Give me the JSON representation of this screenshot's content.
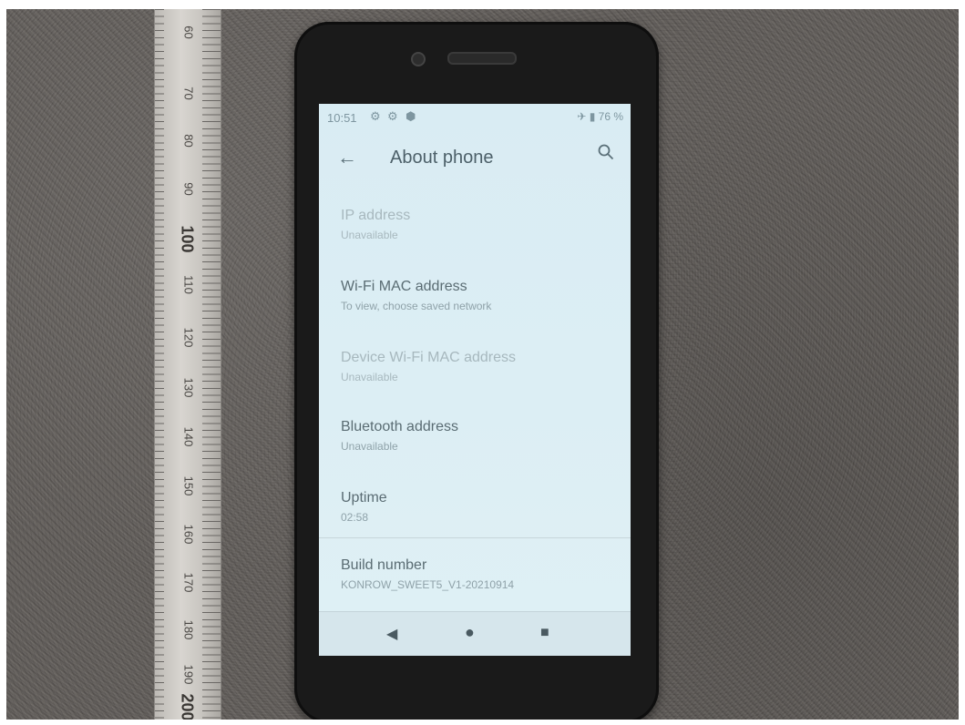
{
  "ruler": {
    "labels": [
      "60",
      "70",
      "80",
      "90",
      "100",
      "110",
      "120",
      "130",
      "140",
      "150",
      "160",
      "170",
      "180",
      "190",
      "200"
    ]
  },
  "status_bar": {
    "time": "10:51",
    "icons": [
      "gear-icon",
      "gear-icon",
      "shield-icon"
    ],
    "battery": "76 %"
  },
  "app_bar": {
    "title": "About phone",
    "back_icon": "arrow-left-icon",
    "search_icon": "search-icon"
  },
  "items": [
    {
      "title": "IP address",
      "subtitle": "Unavailable"
    },
    {
      "title": "Wi-Fi MAC address",
      "subtitle": "To view, choose saved network"
    },
    {
      "title": "Device Wi-Fi MAC address",
      "subtitle": "Unavailable"
    },
    {
      "title": "Bluetooth address",
      "subtitle": "Unavailable"
    },
    {
      "title": "Uptime",
      "subtitle": "02:58"
    },
    {
      "title": "Build number",
      "subtitle": "KONROW_SWEET5_V1-20210914"
    }
  ],
  "nav_bar": {
    "back": "triangle-back-icon",
    "home": "circle-home-icon",
    "recents": "square-recents-icon"
  }
}
